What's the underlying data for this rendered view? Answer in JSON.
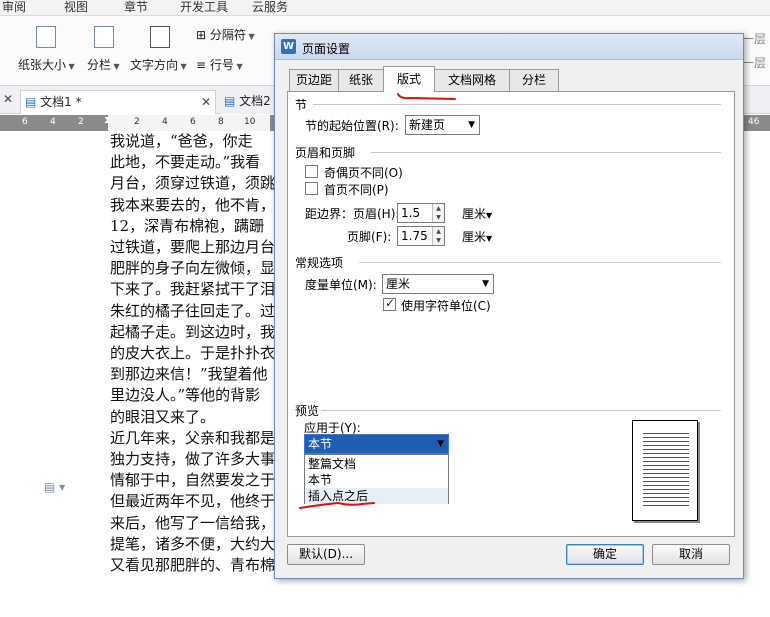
{
  "menu": [
    "审阅",
    "视图",
    "章节",
    "开发工具",
    "云服务"
  ],
  "ribbon": {
    "paper_size": "纸张大小",
    "columns": "分栏",
    "text_direction": "文字方向",
    "separator": "分隔符",
    "line_number": "行号",
    "right_edge": "一层"
  },
  "doc_tabs": [
    {
      "label": "文档1 *",
      "active": true
    },
    {
      "label": "文档2",
      "active": false
    }
  ],
  "ruler": {
    "left_numbers": [
      "6",
      "4",
      "2",
      "2",
      "4",
      "6",
      "8",
      "10"
    ],
    "right_number": "46"
  },
  "document_lines": [
    "我说道，“爸爸，你走",
    "此地，不要走动。”我看",
    "月台，须穿过铁道，须跳",
    "我本来要去的，他不肯，",
    "12，深青布棉袍，蹒跚",
    "过铁道，要爬上那边月台",
    "肥胖的身子向左微倾，显",
    "下来了。我赶紧拭干了泪",
    "朱红的橘子往回走了。过",
    "起橘子走。到这边时，我",
    "的皮大衣上。于是扑扑衣",
    "到那边来信！”我望着他",
    "里边没人。”等他的背影",
    "的眼泪又来了。",
    "近几年来，父亲和我都是",
    "独力支持，做了许多大事",
    "情郁于中，自然要发之于",
    "但最近两年不见，他终于",
    "来后，他写了一信给我，",
    "提笔，诸多不便，大约大",
    "又看见那肥胖的、青布棉"
  ],
  "dialog": {
    "title": "页面设置",
    "tabs": [
      "页边距",
      "纸张",
      "版式",
      "文档网格",
      "分栏"
    ],
    "active_tab": "版式",
    "section": {
      "title": "节",
      "start_label": "节的起始位置(R):",
      "start_value": "新建页"
    },
    "header_footer": {
      "title": "页眉和页脚",
      "odd_even_label": "奇偶页不同(O)",
      "odd_even_checked": false,
      "first_page_label": "首页不同(P)",
      "first_page_checked": false,
      "distance_label": "距边界：页眉(H):",
      "header_value": "1.5",
      "footer_label": "页脚(F):",
      "footer_value": "1.75",
      "unit": "厘米"
    },
    "general": {
      "title": "常规选项",
      "measure_label": "度量单位(M):",
      "measure_value": "厘米",
      "char_unit_label": "使用字符单位(C)",
      "char_unit_checked": true
    },
    "preview": {
      "title": "预览",
      "apply_label": "应用于(Y):",
      "apply_value": "本节",
      "apply_options": [
        "整篇文档",
        "本节",
        "插入点之后"
      ],
      "highlighted_option": "插入点之后"
    },
    "buttons": {
      "default": "默认(D)...",
      "ok": "确定",
      "cancel": "取消"
    }
  },
  "colors": {
    "annotation": "#e01010",
    "dialog_border": "#6d8db8",
    "selected_list_bg": "#1e5fb4",
    "primary_button": "#3d7bd3"
  }
}
